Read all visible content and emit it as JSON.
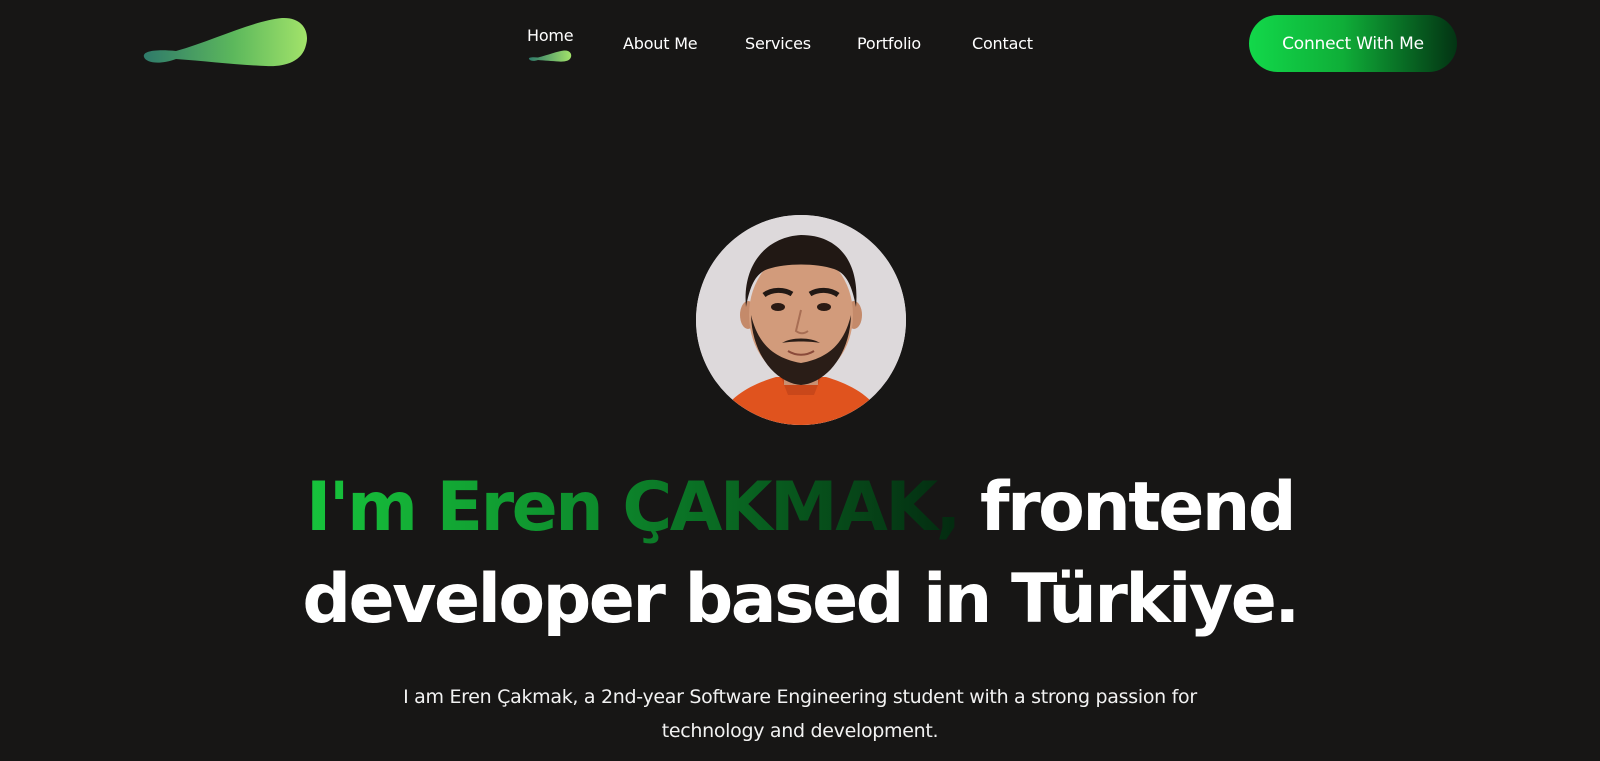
{
  "nav": {
    "items": [
      {
        "label": "Home",
        "active": true
      },
      {
        "label": "About Me"
      },
      {
        "label": "Services"
      },
      {
        "label": "Portfolio"
      },
      {
        "label": "Contact"
      }
    ],
    "cta_label": "Connect With Me"
  },
  "hero": {
    "avatar_icon": "profile-photo",
    "headline_name": "I'm Eren ÇAKMAK,",
    "headline_rest_line1": " frontend",
    "headline_line2": "developer based in Türkiye.",
    "bio_line1": "I am Eren Çakmak, a 2nd-year Software Engineering student with a strong passion for",
    "bio_line2": "technology and development."
  },
  "colors": {
    "background": "#171615",
    "accent_start": "#12d84a",
    "accent_end": "#033313",
    "logo_gradient_start": "#3a8a72",
    "logo_gradient_end": "#9be36a"
  }
}
